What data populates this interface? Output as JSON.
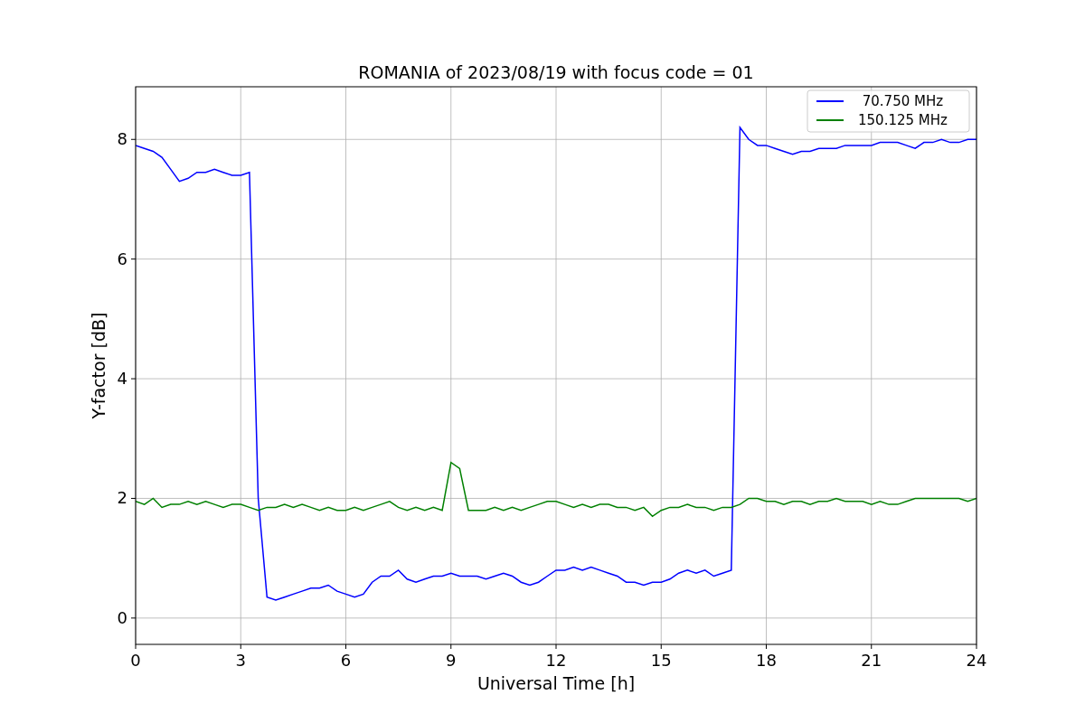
{
  "figure": {
    "chart_data": {
      "type": "line",
      "title": "ROMANIA of 2023/08/19 with focus code = 01",
      "xlabel": "Universal Time [h]",
      "ylabel": "Y-factor [dB]",
      "x": [
        0,
        0.25,
        0.5,
        0.75,
        1,
        1.25,
        1.5,
        1.75,
        2,
        2.25,
        2.5,
        2.75,
        3,
        3.25,
        3.5,
        3.75,
        4,
        4.25,
        4.5,
        4.75,
        5,
        5.25,
        5.5,
        5.75,
        6,
        6.25,
        6.5,
        6.75,
        7,
        7.25,
        7.5,
        7.75,
        8,
        8.25,
        8.5,
        8.75,
        9,
        9.25,
        9.5,
        9.75,
        10,
        10.25,
        10.5,
        10.75,
        11,
        11.25,
        11.5,
        11.75,
        12,
        12.25,
        12.5,
        12.75,
        13,
        13.25,
        13.5,
        13.75,
        14,
        14.25,
        14.5,
        14.75,
        15,
        15.25,
        15.5,
        15.75,
        16,
        16.25,
        16.5,
        16.75,
        17,
        17.25,
        17.5,
        17.75,
        18,
        18.25,
        18.5,
        18.75,
        19,
        19.25,
        19.5,
        19.75,
        20,
        20.25,
        20.5,
        20.75,
        21,
        21.25,
        21.5,
        21.75,
        22,
        22.25,
        22.5,
        22.75,
        23,
        23.25,
        23.5,
        23.75,
        24
      ],
      "series": [
        {
          "name": " 70.750 MHz",
          "color": "#0000ff",
          "values": [
            7.9,
            7.85,
            7.8,
            7.7,
            7.5,
            7.3,
            7.35,
            7.45,
            7.45,
            7.5,
            7.45,
            7.4,
            7.4,
            7.45,
            2.0,
            0.35,
            0.3,
            0.35,
            0.4,
            0.45,
            0.5,
            0.5,
            0.55,
            0.45,
            0.4,
            0.35,
            0.4,
            0.6,
            0.7,
            0.7,
            0.8,
            0.65,
            0.6,
            0.65,
            0.7,
            0.7,
            0.75,
            0.7,
            0.7,
            0.7,
            0.65,
            0.7,
            0.75,
            0.7,
            0.6,
            0.55,
            0.6,
            0.7,
            0.8,
            0.8,
            0.85,
            0.8,
            0.85,
            0.8,
            0.75,
            0.7,
            0.6,
            0.6,
            0.55,
            0.6,
            0.6,
            0.65,
            0.75,
            0.8,
            0.75,
            0.8,
            0.7,
            0.75,
            0.8,
            8.2,
            8.0,
            7.9,
            7.9,
            7.85,
            7.8,
            7.75,
            7.8,
            7.8,
            7.85,
            7.85,
            7.85,
            7.9,
            7.9,
            7.9,
            7.9,
            7.95,
            7.95,
            7.95,
            7.9,
            7.85,
            7.95,
            7.95,
            8.0,
            7.95,
            7.95,
            8.0,
            8.0
          ]
        },
        {
          "name": "150.125 MHz",
          "color": "#008000",
          "values": [
            1.95,
            1.9,
            2.0,
            1.85,
            1.9,
            1.9,
            1.95,
            1.9,
            1.95,
            1.9,
            1.85,
            1.9,
            1.9,
            1.85,
            1.8,
            1.85,
            1.85,
            1.9,
            1.85,
            1.9,
            1.85,
            1.8,
            1.85,
            1.8,
            1.8,
            1.85,
            1.8,
            1.85,
            1.9,
            1.95,
            1.85,
            1.8,
            1.85,
            1.8,
            1.85,
            1.8,
            2.6,
            2.5,
            1.8,
            1.8,
            1.8,
            1.85,
            1.8,
            1.85,
            1.8,
            1.85,
            1.9,
            1.95,
            1.95,
            1.9,
            1.85,
            1.9,
            1.85,
            1.9,
            1.9,
            1.85,
            1.85,
            1.8,
            1.85,
            1.7,
            1.8,
            1.85,
            1.85,
            1.9,
            1.85,
            1.85,
            1.8,
            1.85,
            1.85,
            1.9,
            2.0,
            2.0,
            1.95,
            1.95,
            1.9,
            1.95,
            1.95,
            1.9,
            1.95,
            1.95,
            2.0,
            1.95,
            1.95,
            1.95,
            1.9,
            1.95,
            1.9,
            1.9,
            1.95,
            2.0,
            2.0,
            2.0,
            2.0,
            2.0,
            2.0,
            1.95,
            2.0
          ]
        }
      ],
      "xlim": [
        0,
        24
      ],
      "ylim": [
        -0.44,
        8.88
      ],
      "xticks": [
        0,
        3,
        6,
        9,
        12,
        15,
        18,
        21,
        24
      ],
      "yticks": [
        0,
        2,
        4,
        6,
        8
      ],
      "grid": true,
      "legend": true
    }
  }
}
